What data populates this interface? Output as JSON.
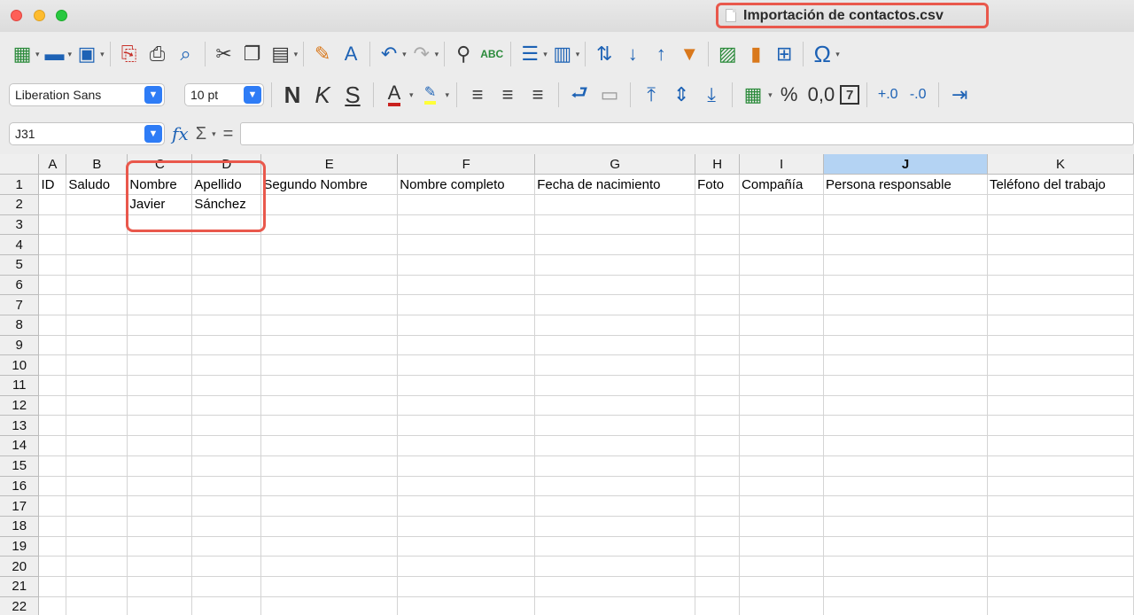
{
  "window": {
    "title": "Importación de contactos.csv",
    "traffic_lights": [
      "close",
      "minimize",
      "zoom"
    ]
  },
  "toolbar": {
    "standard_icons": [
      "new-spreadsheet-icon",
      "open-folder-icon",
      "save-icon",
      "export-pdf-icon",
      "print-icon",
      "print-preview-icon",
      "cut-icon",
      "copy-icon",
      "paste-icon",
      "clone-formatting-icon",
      "clear-formatting-icon",
      "undo-icon",
      "redo-icon",
      "find-replace-icon",
      "spellcheck-icon",
      "rows-icon",
      "columns-icon",
      "sort-icon",
      "sort-ascending-icon",
      "sort-descending-icon",
      "autofilter-icon",
      "insert-image-icon",
      "insert-chart-icon",
      "pivot-table-icon",
      "special-character-icon"
    ],
    "spellcheck_label": "ABC",
    "omega_label": "Ω"
  },
  "formatting": {
    "font_name": "Liberation Sans",
    "font_size": "10 pt",
    "bold_label": "N",
    "italic_label": "K",
    "underline_label": "S",
    "font_color_label": "A",
    "percent_label": "%",
    "number_label": "0,0",
    "date_label": "7"
  },
  "formula_bar": {
    "name_box": "J31",
    "fx_label": "fx",
    "sigma_label": "Σ",
    "equals_label": "=",
    "content": ""
  },
  "sheet": {
    "columns": [
      "A",
      "B",
      "C",
      "D",
      "E",
      "F",
      "G",
      "H",
      "I",
      "J",
      "K"
    ],
    "selected_column": "J",
    "row_numbers": [
      "1",
      "2",
      "3",
      "4",
      "5",
      "6",
      "7",
      "8",
      "9",
      "10",
      "11",
      "12",
      "13",
      "14",
      "15",
      "16",
      "17",
      "18",
      "19",
      "20",
      "21",
      "22"
    ],
    "row1": [
      "ID",
      "Saludo",
      "Nombre",
      "Apellido",
      "Segundo Nombre",
      "Nombre completo",
      "Fecha de nacimiento",
      "Foto",
      "Compañía",
      "Persona responsable",
      "Teléfono del trabajo"
    ],
    "row2": [
      "",
      "",
      "Javier",
      "Sánchez",
      "",
      "",
      "",
      "",
      "",
      "",
      ""
    ]
  },
  "colors": {
    "highlight_border": "#e9584c",
    "selected_header": "#b4d3f3",
    "accent": "#2e7cf6"
  }
}
